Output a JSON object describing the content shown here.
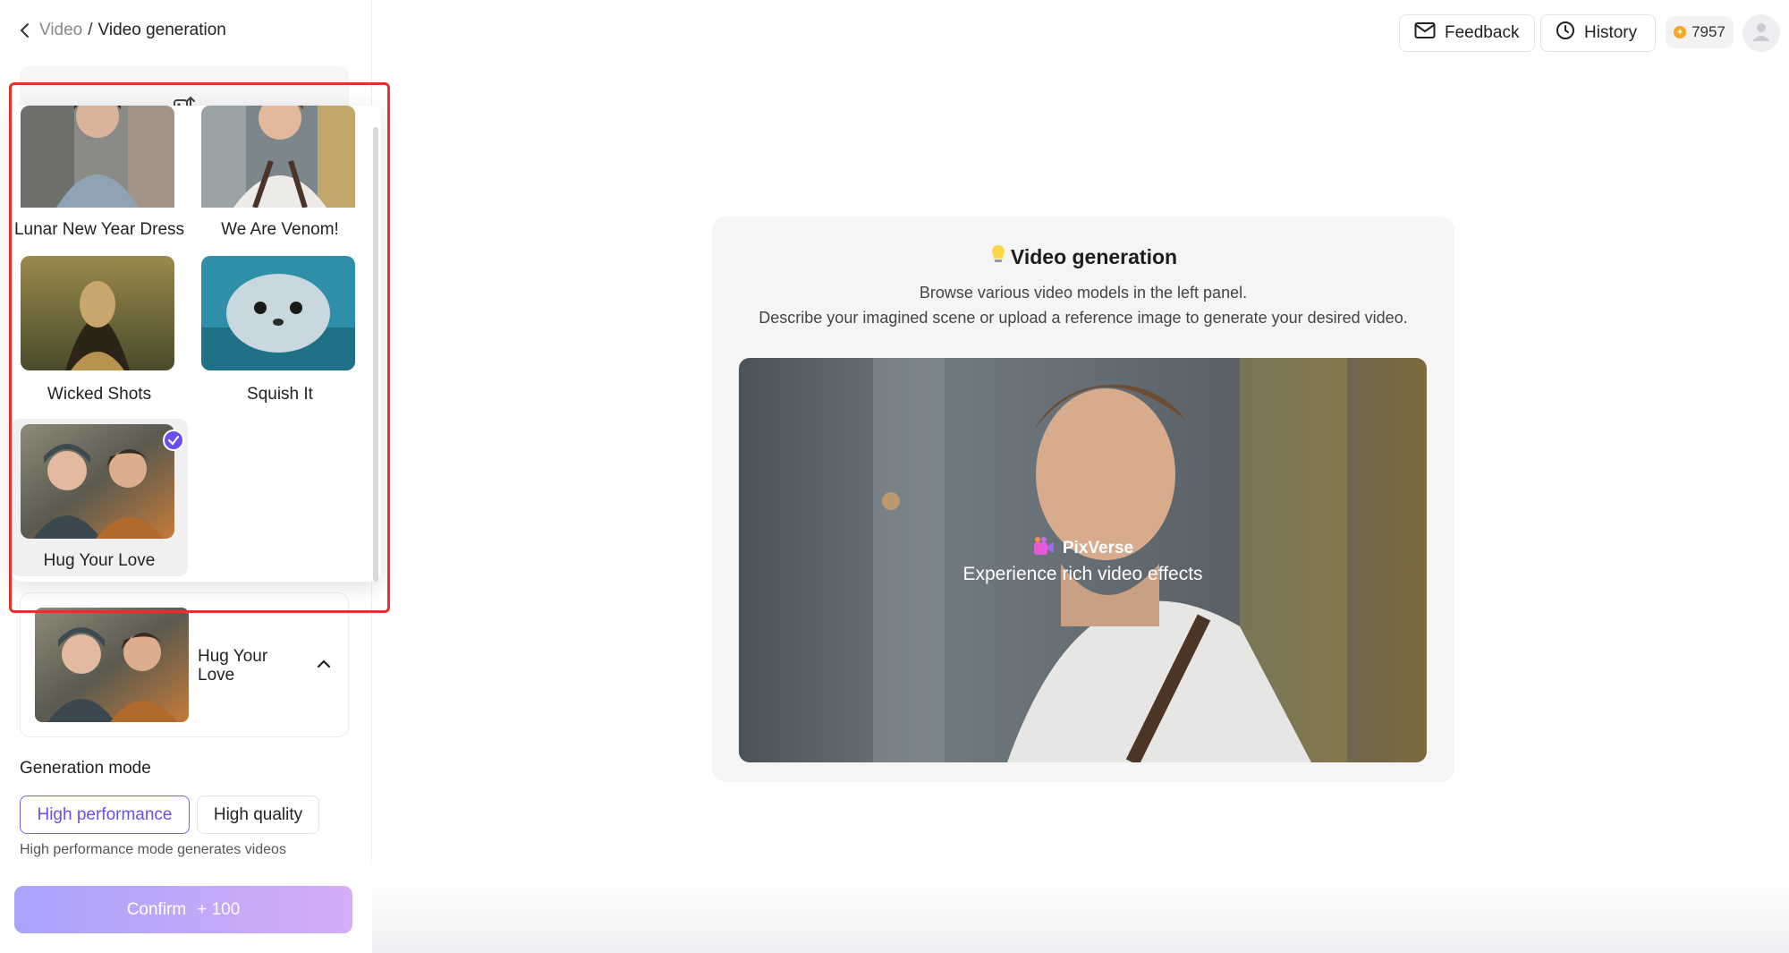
{
  "breadcrumb": {
    "parent": "Video",
    "separator": "/",
    "current": "Video generation"
  },
  "header": {
    "feedback_label": "Feedback",
    "history_label": "History",
    "credits": "7957"
  },
  "effects": [
    {
      "label": "Lunar New Year Dress",
      "selected": false
    },
    {
      "label": "We Are Venom!",
      "selected": false
    },
    {
      "label": "Wicked Shots",
      "selected": false
    },
    {
      "label": "Squish It",
      "selected": false
    },
    {
      "label": "Hug Your Love",
      "selected": true
    }
  ],
  "selected_effect": {
    "name": "Hug Your Love"
  },
  "generation_mode": {
    "label": "Generation mode",
    "options": [
      "High performance",
      "High quality"
    ],
    "selected": "High performance",
    "description": "High performance mode generates videos"
  },
  "confirm": {
    "label": "Confirm",
    "cost": "+ 100"
  },
  "main": {
    "title": "Video generation",
    "desc_line1": "Browse various video models in the left panel.",
    "desc_line2": "Describe your imagined scene or upload a reference image to generate your desired video.",
    "brand": "PixVerse",
    "tagline": "Experience rich video effects"
  },
  "colors": {
    "accent": "#6b4ef0",
    "highlight_frame": "#e4312b",
    "coin": "#f6a623"
  },
  "icons": [
    "chevron-left-icon",
    "upload-icon",
    "chevron-up-icon",
    "mail-icon",
    "clock-icon",
    "coin-icon",
    "user-icon",
    "lightbulb-icon",
    "check-icon",
    "pixverse-logo-icon"
  ]
}
